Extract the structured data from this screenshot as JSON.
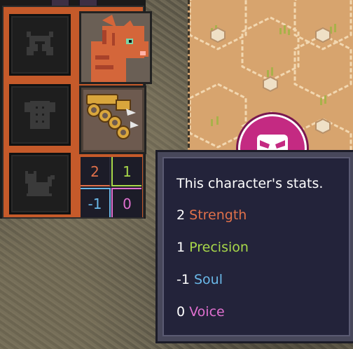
{
  "tooltip": {
    "title": "This character's stats.",
    "lines": [
      {
        "value": "2",
        "name": "Strength",
        "color": "#e0704a"
      },
      {
        "value": "1",
        "name": "Precision",
        "color": "#a8d84a"
      },
      {
        "value": "-1",
        "name": "Soul",
        "color": "#6ab8e8"
      },
      {
        "value": "0",
        "name": "Voice",
        "color": "#e070d0"
      }
    ]
  },
  "stats_grid": [
    {
      "value": "2",
      "color": "#e0704a"
    },
    {
      "value": "1",
      "color": "#a8d84a"
    },
    {
      "value": "-1",
      "color": "#6ab8e8"
    },
    {
      "value": "0",
      "color": "#e070d0"
    }
  ],
  "icons": {
    "helmet_slot": "helmet-icon",
    "armor_slot": "armor-icon",
    "pet_slot": "cat-icon",
    "portrait": "cat-portrait",
    "item": "brass-knuckles-icon",
    "token": "angry-face-icon"
  },
  "colors": {
    "panel_frame": "#c55a2a",
    "tooltip_bg": "#23233a",
    "token": "#c42a82"
  }
}
